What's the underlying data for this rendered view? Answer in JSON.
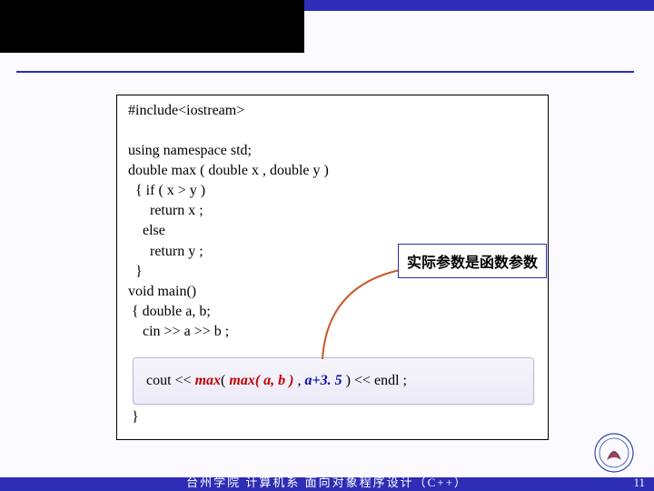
{
  "code": {
    "l1": "#include<iostream>",
    "blank": " ",
    "l2": "using namespace std;",
    "l3": "double max ( double x , double y )",
    "l4": "  { if ( x > y )",
    "l5": "      return x ;",
    "l6": "    else",
    "l7": "      return y ;",
    "l8": "  }",
    "l9": "void main()",
    "l10": " { double a, b;",
    "l11": "    cin >> a >> b ;",
    "l12": " }",
    "hl_prefix": "cout << ",
    "hl_max_outer": "max",
    "hl_open": "( ",
    "hl_inner": "max( a, b )",
    "hl_comma": " , ",
    "hl_arg2": "a+3. 5",
    "hl_close": " )",
    "hl_suffix": " << endl ;"
  },
  "annotation": "实际参数是函数参数",
  "footer": "台州学院 计算机系 面向对象程序设计（C++）",
  "page": "11"
}
